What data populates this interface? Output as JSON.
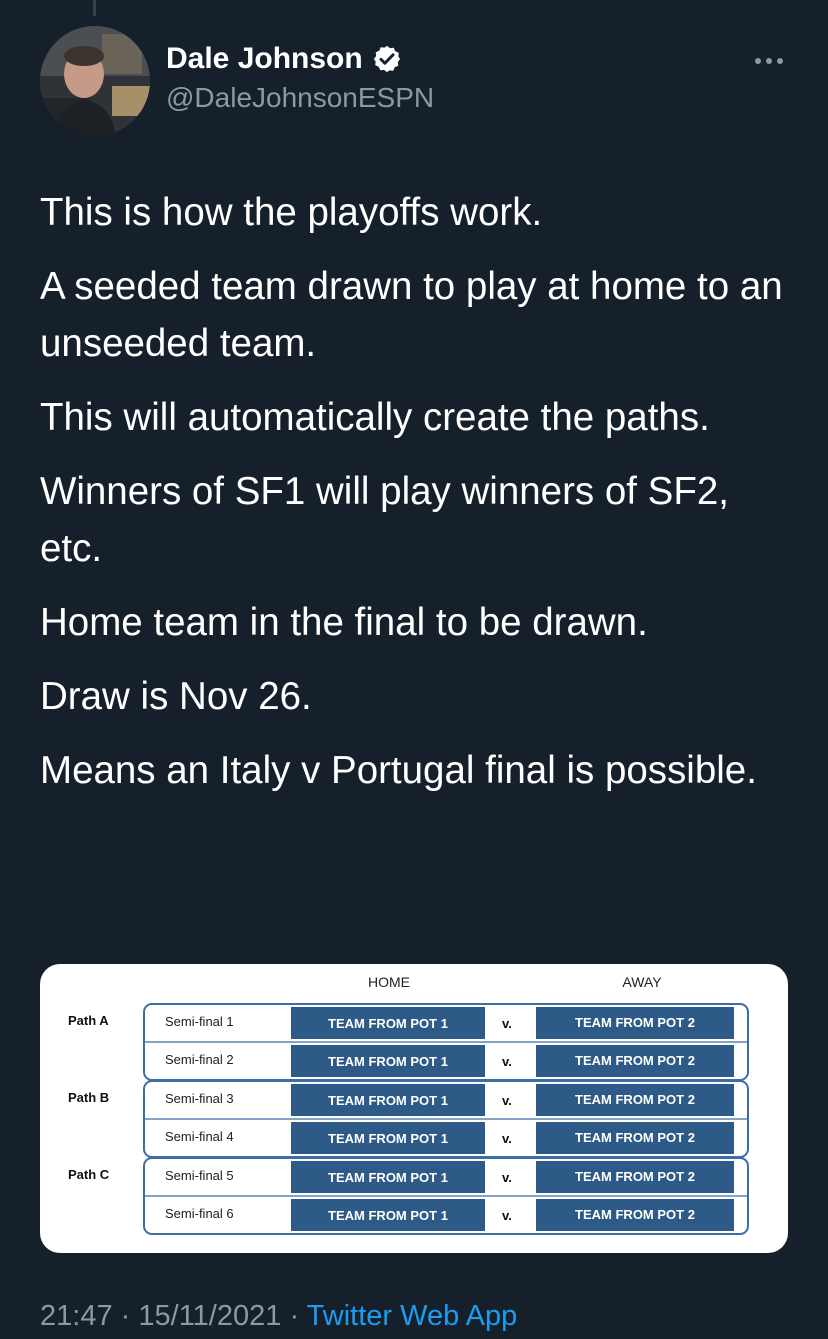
{
  "tweet": {
    "display_name": "Dale Johnson",
    "handle": "@DaleJohnsonESPN",
    "paragraphs": [
      "This is how the playoffs work.",
      "A seeded team drawn to play at home to an unseeded team.",
      "This will automatically create the paths.",
      "Winners of SF1 will play winners of SF2, etc.",
      "Home team in the final to be drawn.",
      "Draw is Nov 26.",
      "Means an Italy v Portugal final is possible."
    ],
    "time": "21:47",
    "date": "15/11/2021",
    "separator": "·",
    "source": "Twitter Web App"
  },
  "media_table": {
    "home_header": "HOME",
    "away_header": "AWAY",
    "versus": "v.",
    "paths": [
      {
        "label": "Path A",
        "rows": [
          {
            "semi": "Semi-final 1",
            "home": "TEAM FROM POT 1",
            "away": "TEAM FROM POT 2"
          },
          {
            "semi": "Semi-final 2",
            "home": "TEAM FROM POT 1",
            "away": "TEAM FROM POT 2"
          }
        ]
      },
      {
        "label": "Path B",
        "rows": [
          {
            "semi": "Semi-final 3",
            "home": "TEAM FROM POT 1",
            "away": "TEAM FROM POT 2"
          },
          {
            "semi": "Semi-final 4",
            "home": "TEAM FROM POT 1",
            "away": "TEAM FROM POT 2"
          }
        ]
      },
      {
        "label": "Path C",
        "rows": [
          {
            "semi": "Semi-final 5",
            "home": "TEAM FROM POT 1",
            "away": "TEAM FROM POT 2"
          },
          {
            "semi": "Semi-final 6",
            "home": "TEAM FROM POT 1",
            "away": "TEAM FROM POT 2"
          }
        ]
      }
    ]
  },
  "colors": {
    "background": "#15202b",
    "secondary_text": "#8b98a5",
    "link": "#1d9bf0",
    "verified": "#ffffff",
    "team_cell": "#2e5a87",
    "path_border": "#3a6ea5"
  },
  "icons": {
    "verified": "verified-badge-icon",
    "more": "more-horizontal-icon"
  }
}
